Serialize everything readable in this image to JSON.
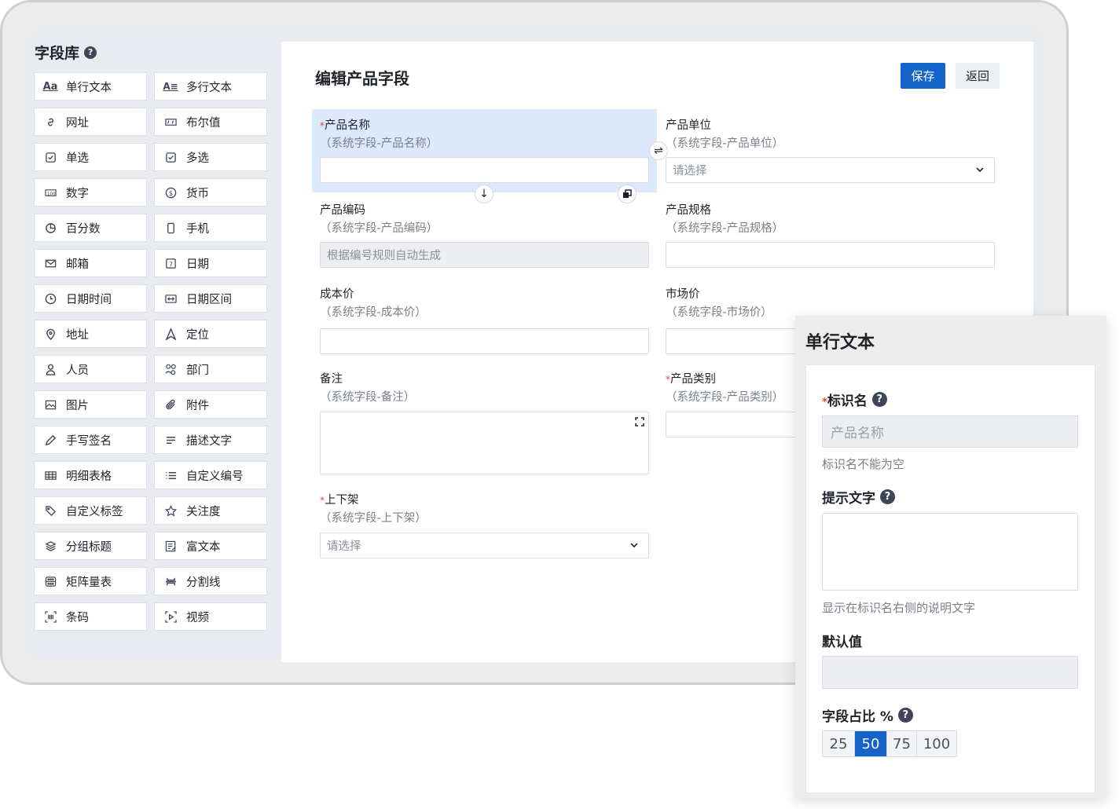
{
  "library": {
    "title": "字段库",
    "items": [
      {
        "label": "单行文本",
        "icon": "text-aa-icon"
      },
      {
        "label": "多行文本",
        "icon": "multiline-text-icon"
      },
      {
        "label": "网址",
        "icon": "link-icon"
      },
      {
        "label": "布尔值",
        "icon": "boolean-icon"
      },
      {
        "label": "单选",
        "icon": "radio-icon"
      },
      {
        "label": "多选",
        "icon": "checkbox-icon"
      },
      {
        "label": "数字",
        "icon": "number-icon"
      },
      {
        "label": "货币",
        "icon": "currency-icon"
      },
      {
        "label": "百分数",
        "icon": "percent-icon"
      },
      {
        "label": "手机",
        "icon": "phone-icon"
      },
      {
        "label": "邮箱",
        "icon": "mail-icon"
      },
      {
        "label": "日期",
        "icon": "date-icon"
      },
      {
        "label": "日期时间",
        "icon": "clock-icon"
      },
      {
        "label": "日期区间",
        "icon": "date-range-icon"
      },
      {
        "label": "地址",
        "icon": "location-pin-icon"
      },
      {
        "label": "定位",
        "icon": "navigate-icon"
      },
      {
        "label": "人员",
        "icon": "person-icon"
      },
      {
        "label": "部门",
        "icon": "department-icon"
      },
      {
        "label": "图片",
        "icon": "image-icon"
      },
      {
        "label": "附件",
        "icon": "paperclip-icon"
      },
      {
        "label": "手写签名",
        "icon": "pen-icon"
      },
      {
        "label": "描述文字",
        "icon": "description-icon"
      },
      {
        "label": "明细表格",
        "icon": "table-icon"
      },
      {
        "label": "自定义编号",
        "icon": "numbered-list-icon"
      },
      {
        "label": "自定义标签",
        "icon": "tag-icon"
      },
      {
        "label": "关注度",
        "icon": "star-icon"
      },
      {
        "label": "分组标题",
        "icon": "layers-icon"
      },
      {
        "label": "富文本",
        "icon": "rich-text-icon"
      },
      {
        "label": "矩阵量表",
        "icon": "matrix-icon"
      },
      {
        "label": "分割线",
        "icon": "divider-icon"
      },
      {
        "label": "条码",
        "icon": "barcode-icon"
      },
      {
        "label": "视频",
        "icon": "video-icon"
      }
    ]
  },
  "form": {
    "title": "编辑产品字段",
    "save_label": "保存",
    "back_label": "返回",
    "fields": {
      "name": {
        "label": "产品名称",
        "sub": "（系统字段-产品名称）",
        "value": ""
      },
      "unit": {
        "label": "产品单位",
        "sub": "（系统字段-产品单位）",
        "placeholder": "请选择"
      },
      "code": {
        "label": "产品编码",
        "sub": "（系统字段-产品编码）",
        "value": "根据编号规则自动生成"
      },
      "spec": {
        "label": "产品规格",
        "sub": "（系统字段-产品规格）",
        "value": ""
      },
      "cost": {
        "label": "成本价",
        "sub": "（系统字段-成本价）",
        "value": ""
      },
      "market": {
        "label": "市场价",
        "sub": "（系统字段-市场价）",
        "value": ""
      },
      "note": {
        "label": "备注",
        "sub": "（系统字段-备注）",
        "value": ""
      },
      "category": {
        "label": "产品类别",
        "sub": "（系统字段-产品类别）",
        "value": ""
      },
      "shelf": {
        "label": "上下架",
        "sub": "（系统字段-上下架）",
        "placeholder": "请选择"
      }
    }
  },
  "props": {
    "title": "单行文本",
    "id_label": "标识名",
    "id_value": "产品名称",
    "id_hint": "标识名不能为空",
    "tip_label": "提示文字",
    "tip_hint": "显示在标识名右侧的说明文字",
    "default_label": "默认值",
    "ratio_label": "字段占比 %",
    "ratio_options": [
      "25",
      "50",
      "75",
      "100"
    ],
    "ratio_selected": "50"
  },
  "colors": {
    "primary": "#1363c9",
    "required": "#e3483a",
    "selected_bg": "#dce8fb"
  }
}
